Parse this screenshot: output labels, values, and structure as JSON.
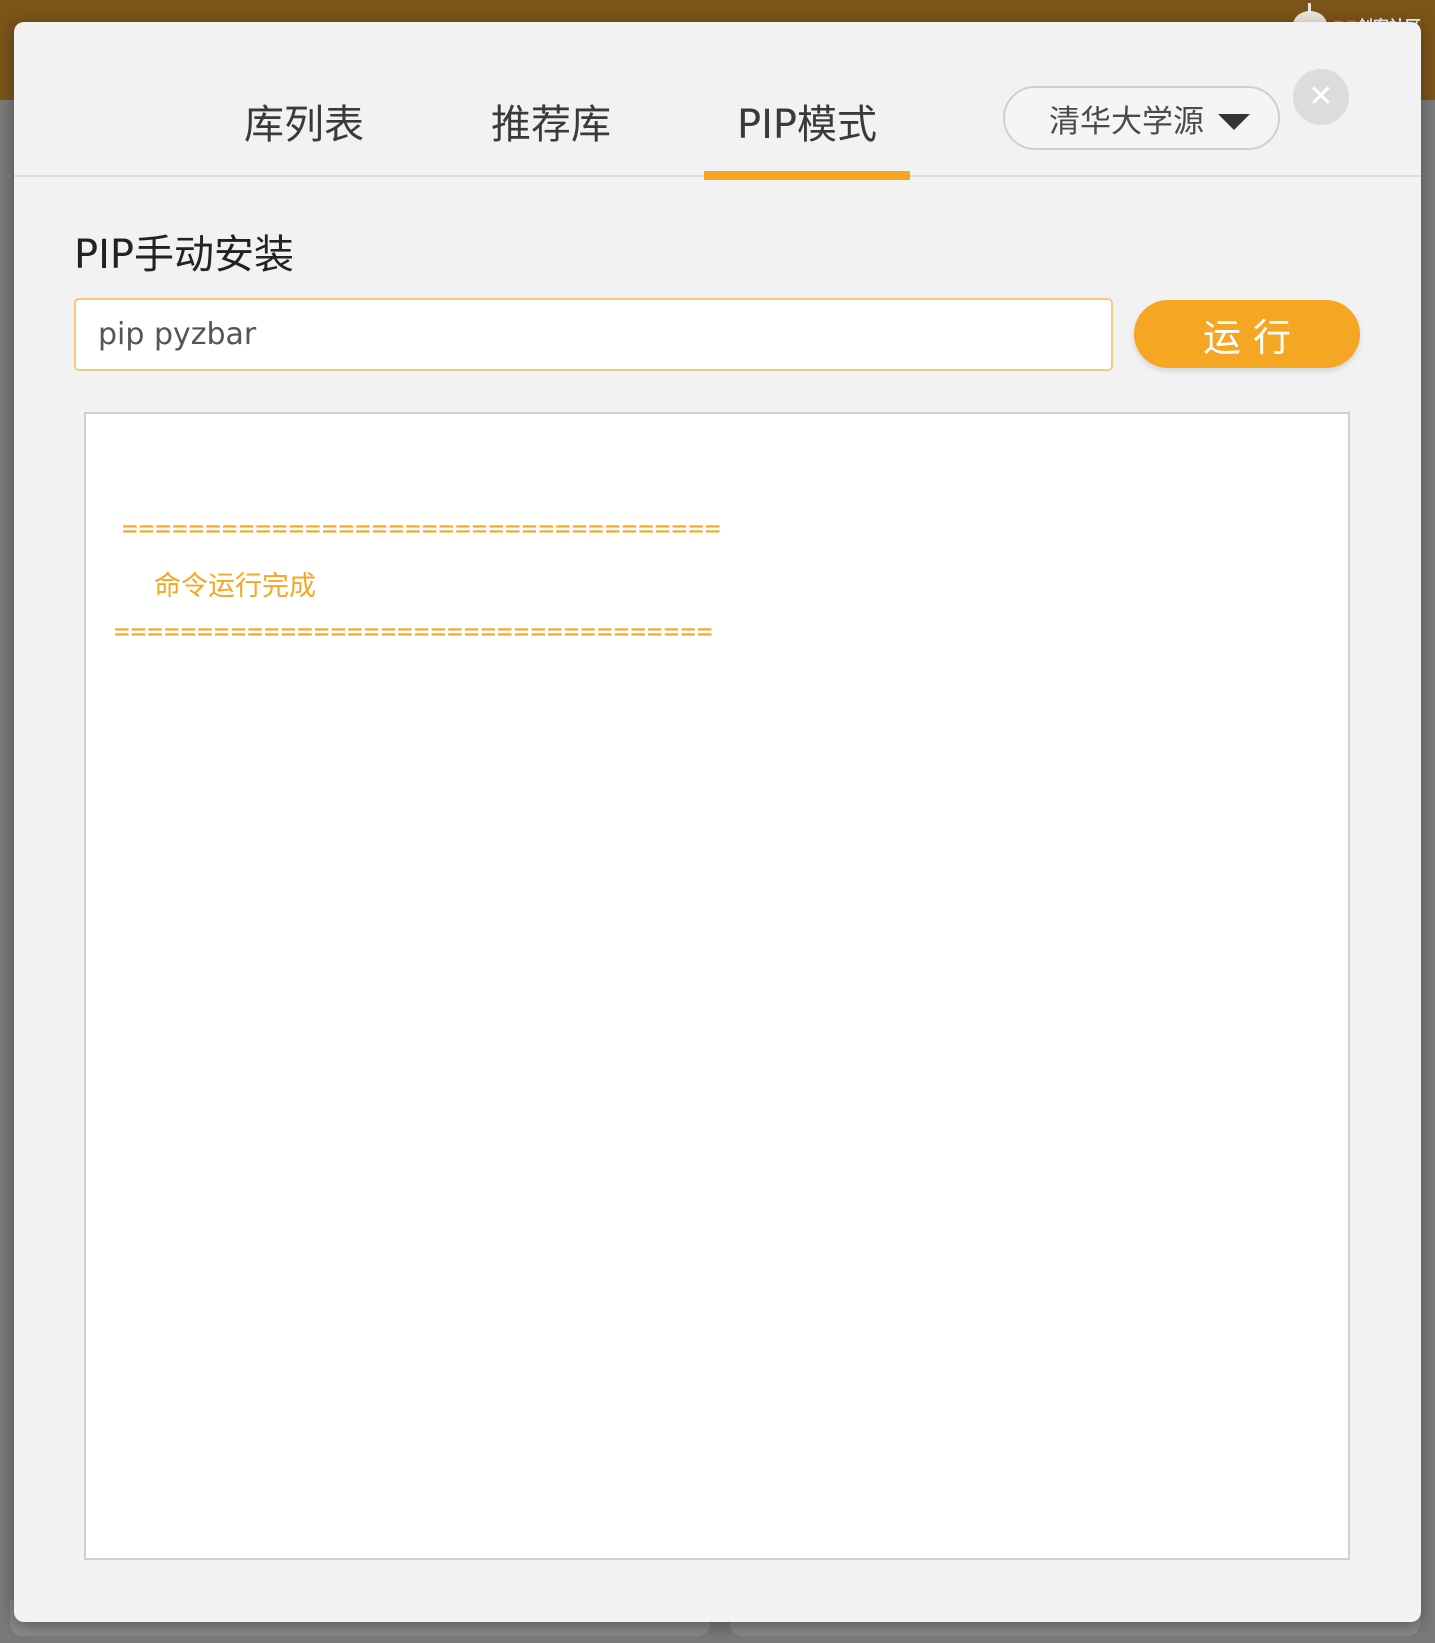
{
  "background": {
    "watermark": {
      "brand_prefix": "DF",
      "brand_suffix": "创客社区"
    }
  },
  "dialog": {
    "tabs": [
      {
        "label": "库列表",
        "active": false
      },
      {
        "label": "推荐库",
        "active": false
      },
      {
        "label": "PIP模式",
        "active": true
      }
    ],
    "source_select": {
      "selected": "清华大学源"
    },
    "close_icon": "close-icon",
    "section_title": "PIP手动安装",
    "command_input": {
      "value": "pip pyzbar"
    },
    "run_button": {
      "label": "运行"
    },
    "output": {
      "separator_top": "====================================",
      "message": "命令运行完成",
      "separator_bottom": "===================================="
    }
  },
  "colors": {
    "accent": "#f5a623",
    "topbar": "#7a5418",
    "dialog_bg": "#f2f2f2",
    "input_border": "#f5c978"
  }
}
